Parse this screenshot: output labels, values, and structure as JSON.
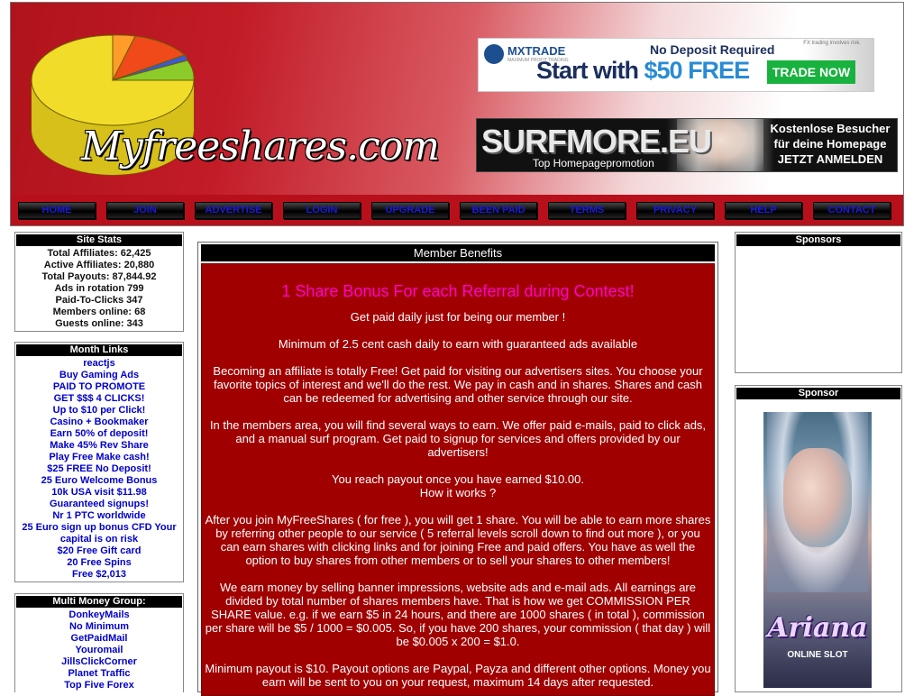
{
  "site": {
    "logo_text": "Myfreeshares.com"
  },
  "ads": {
    "mxtrade": {
      "brand": "MXTRADE",
      "brand_sub": "MAXIMUM PROFIT TRADING",
      "headline": "No Deposit Required",
      "start_prefix": "Start with ",
      "start_amount": "$50 FREE",
      "button": "TRADE NOW",
      "risk": "FX trading involves risk."
    },
    "surfmore": {
      "brand": "SURFMORE.EU",
      "sub": "Top Homepagepromotion",
      "right_line1": "Kostenlose Besucher",
      "right_line2": "für deine Homepage",
      "right_line3": "JETZT ANMELDEN"
    }
  },
  "nav": [
    "HOME",
    "JOIN",
    "ADVERTISE",
    "LOGIN",
    "UPGRADE",
    "BEEN PAID",
    "TERMS",
    "PRIVACY",
    "HELP",
    "CONTACT"
  ],
  "site_stats": {
    "title": "Site Stats",
    "lines": [
      "Total Affiliates: 62,425",
      "Active Affiliates: 20,880",
      "Total Payouts: 87,844.92",
      "Ads in rotation 799",
      "Paid-To-Clicks 347",
      "Members online: 68",
      "Guests online: 343"
    ]
  },
  "month_links": {
    "title": "Month Links",
    "items": [
      "reactjs",
      "Buy Gaming Ads",
      "PAID TO PROMOTE",
      "GET $$$ 4 CLICKS!",
      "Up to $10 per Click!",
      "Casino + Bookmaker",
      "Earn 50% of deposit!",
      "Make 45% Rev Share",
      "Play Free Make cash!",
      "$25 FREE No Deposit!",
      "25 Euro Welcome Bonus",
      "10k USA visit $11.98",
      "Guaranteed signups!",
      "Nr 1 PTC worldwide",
      "25 Euro sign up bonus CFD Your capital is on risk",
      "$20 Free Gift card",
      "20 Free Spins",
      "Free $2,013"
    ]
  },
  "multi_money": {
    "title": "Multi Money Group:",
    "items": [
      "DonkeyMails",
      "No Minimum",
      "GetPaidMail",
      "Youromail",
      "JillsClickCorner",
      "Planet Traffic",
      "Top Five Forex"
    ]
  },
  "main": {
    "header": "Member Benefits",
    "title": "1 Share Bonus For each Referral during Contest!",
    "paragraphs": [
      "Get paid daily just for being our member !",
      "Minimum of 2.5 cent cash daily to earn with guaranteed ads available",
      "Becoming an affiliate is totally Free! Get paid for visiting our advertisers sites. You choose your favorite topics of interest and we'll do the rest. We pay in cash and in shares. Shares and cash can be redeemed for advertising and other service through our site.",
      "In the members area, you will find several ways to earn. We offer paid e-mails, paid to click ads, and a manual surf program. Get paid to signup for services and offers provided by our advertisers!",
      "You reach payout once you have earned $10.00.",
      "How it works ?",
      "After you join MyFreeShares ( for free ), you will get 1 share. You will be able to earn more shares by referring other people to our service ( 5 referral levels scroll down to find out more ), or you can earn shares with clicking links and for joining Free and paid offers. You have as well the option to buy shares from other members or to sell your shares to other members!",
      "We earn money by selling banner impressions, website ads and e-mail ads. All earnings are divided by total number of shares members have. That is how we get COMMISSION PER SHARE value. e.g. if we earn $5 in 24 hours, and there are 1000 shares ( in total ), commission per share will be $5 / 1000 = $0.005. So, if you have 200 shares, your commission ( that day ) will be $0.005 x 200 = $1.0.",
      "Minimum payout is $10. Payout options are Paypal, Payza and different other options. Money you earn will be sent to you on your request, maximum 14 days after requested."
    ]
  },
  "sponsors": {
    "title1": "Sponsors",
    "title2": "Sponsor",
    "ariana_logo": "Ariana",
    "ariana_sub": "ONLINE SLOT"
  },
  "colors": {
    "header_red": "#b7101a",
    "main_red": "#a00000",
    "title_pink": "#ff00cc",
    "nav_text": "#1a1adc",
    "link_blue": "#0000cc"
  }
}
